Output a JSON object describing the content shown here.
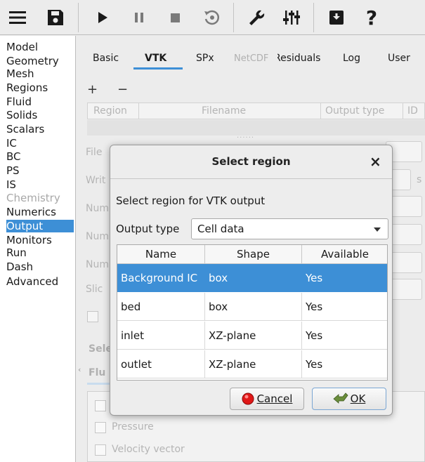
{
  "toolbar": {
    "icons": [
      "menu-icon",
      "save-icon",
      "play-icon",
      "pause-icon",
      "stop-icon",
      "reset-icon",
      "wrench-icon",
      "sliders-icon",
      "archive-icon",
      "help-icon"
    ]
  },
  "nav": {
    "items": [
      {
        "label": "Model",
        "state": "normal"
      },
      {
        "label": "Geometry",
        "state": "normal"
      },
      {
        "label": "Mesh",
        "state": "normal"
      },
      {
        "label": "Regions",
        "state": "normal"
      },
      {
        "label": "Fluid",
        "state": "normal"
      },
      {
        "label": "Solids",
        "state": "normal"
      },
      {
        "label": "Scalars",
        "state": "normal"
      },
      {
        "label": "IC",
        "state": "normal"
      },
      {
        "label": "BC",
        "state": "normal"
      },
      {
        "label": "PS",
        "state": "normal"
      },
      {
        "label": "IS",
        "state": "normal"
      },
      {
        "label": "Chemistry",
        "state": "disabled"
      },
      {
        "label": "Numerics",
        "state": "normal"
      },
      {
        "label": "Output",
        "state": "selected"
      },
      {
        "label": "Monitors",
        "state": "normal"
      },
      {
        "label": "Run",
        "state": "normal"
      },
      {
        "label": "Dash",
        "state": "normal"
      },
      {
        "label": "Advanced",
        "state": "normal"
      }
    ]
  },
  "main": {
    "tabs": [
      {
        "label": "Basic",
        "state": "normal"
      },
      {
        "label": "VTK",
        "state": "active"
      },
      {
        "label": "SPx",
        "state": "normal"
      },
      {
        "label": "NetCDF",
        "state": "disabled"
      },
      {
        "label": "Residuals",
        "state": "normal"
      },
      {
        "label": "Log",
        "state": "normal"
      },
      {
        "label": "User",
        "state": "normal"
      }
    ],
    "add_label": "+",
    "remove_label": "−",
    "table_headers": [
      "Region",
      "Filename",
      "Output type",
      "ID"
    ],
    "splitter": "......",
    "left_labels": [
      "File",
      "Writ",
      "Num",
      "Num",
      "Num",
      "Slic"
    ],
    "unit_s": "s",
    "section_label": "Sele",
    "subtab_label": "Flu",
    "scroll_arrow": "‹",
    "checkboxes": [
      "Pressure",
      "Velocity vector"
    ]
  },
  "dialog": {
    "title": "Select region",
    "close_label": "×",
    "prompt": "Select region for VTK output",
    "output_type_label": "Output type",
    "output_type_value": "Cell data",
    "columns": [
      "Name",
      "Shape",
      "Available"
    ],
    "rows": [
      {
        "name": "Background IC",
        "shape": "box",
        "available": "Yes",
        "selected": true
      },
      {
        "name": "bed",
        "shape": "box",
        "available": "Yes",
        "selected": false
      },
      {
        "name": "inlet",
        "shape": "XZ-plane",
        "available": "Yes",
        "selected": false
      },
      {
        "name": "outlet",
        "shape": "XZ-plane",
        "available": "Yes",
        "selected": false
      }
    ],
    "cancel_label": "Cancel",
    "ok_label": "OK"
  },
  "colors": {
    "accent": "#3d8fd6",
    "cancel_red": "#e01818",
    "ok_green": "#6b8e3c"
  }
}
